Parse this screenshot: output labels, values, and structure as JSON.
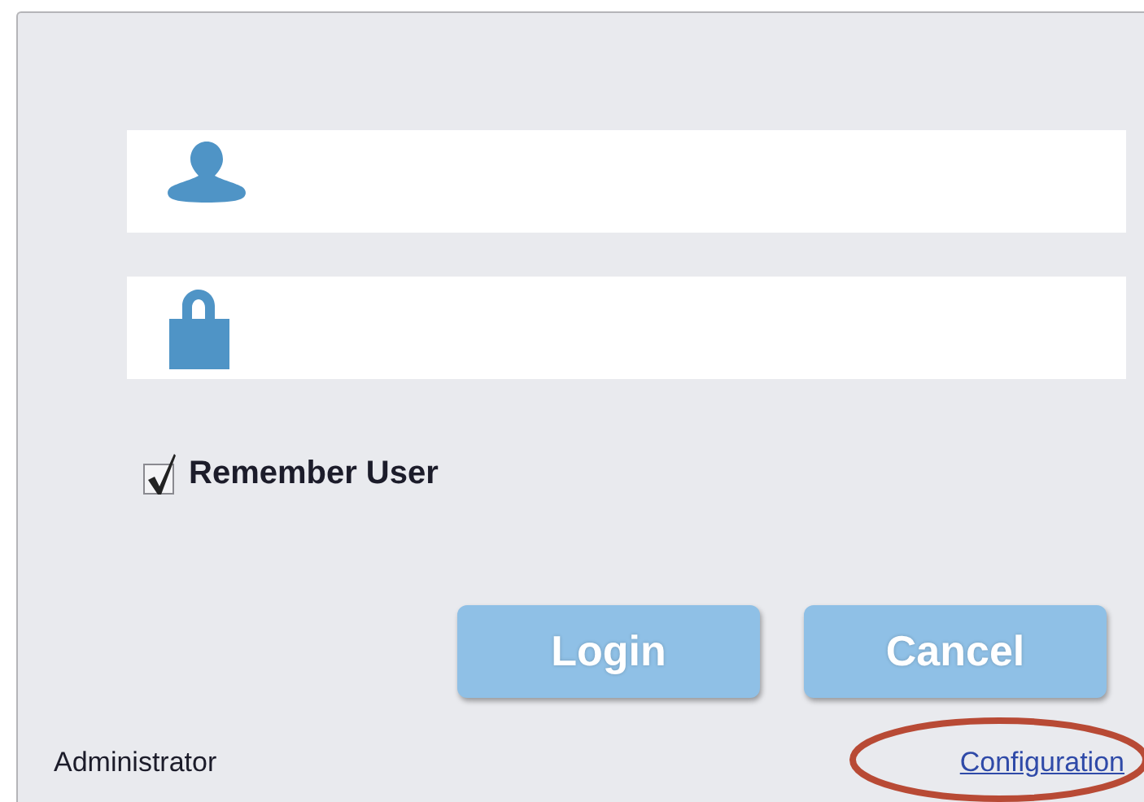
{
  "remember_user": {
    "label": "Remember User",
    "checked": true
  },
  "buttons": [
    {
      "label": "Login"
    },
    {
      "label": "Cancel"
    }
  ],
  "footer": {
    "role": "Administrator",
    "link": "Configuration",
    "link_circled": true
  }
}
